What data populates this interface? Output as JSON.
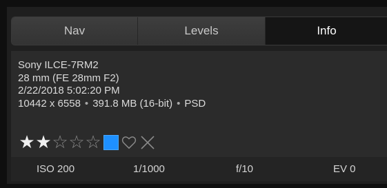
{
  "tabs": [
    {
      "label": "Nav",
      "active": false
    },
    {
      "label": "Levels",
      "active": false
    },
    {
      "label": "Info",
      "active": true
    }
  ],
  "info": {
    "camera": "Sony ILCE-7RM2",
    "lens": "28 mm (FE 28mm F2)",
    "datetime": "2/22/2018 5:02:20 PM",
    "dimensions": "10442 x 6558",
    "filesize": "391.8 MB (16-bit)",
    "format": "PSD",
    "separator": "•"
  },
  "rating": {
    "stars_total": 5,
    "stars_filled": 2,
    "filled_glyph": "★",
    "empty_glyph": "☆",
    "color_label": "#1e90ff",
    "heart_icon": "heart-outline-icon",
    "reject_icon": "x-icon"
  },
  "exif": {
    "iso": "ISO 200",
    "shutter": "1/1000",
    "aperture": "f/10",
    "ev": "EV 0"
  },
  "colors": {
    "panel_bg": "#1f1f1f",
    "tab_active_bg": "#151515",
    "info_bg": "#2b2b2b",
    "accent_blue": "#1e90ff"
  }
}
